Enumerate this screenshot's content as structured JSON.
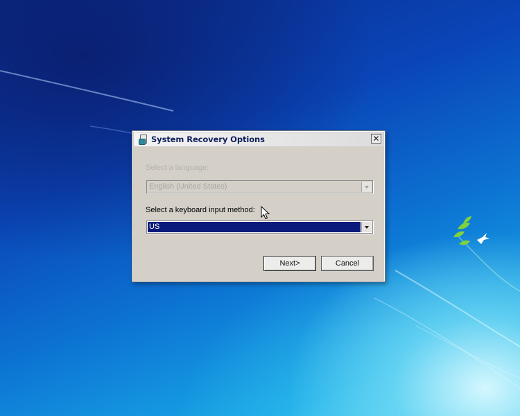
{
  "dialog": {
    "title": "System Recovery Options",
    "close_glyph": "✕",
    "language": {
      "label": "Select a language:",
      "value": "English (United States)",
      "enabled": false
    },
    "keyboard": {
      "label": "Select a keyboard input method:",
      "value": "US",
      "enabled": true
    },
    "buttons": {
      "next": "Next>",
      "cancel": "Cancel"
    }
  },
  "icons": {
    "title": "recovery-disc-icon",
    "close": "close-icon",
    "dropdown": "chevron-down-icon",
    "cursor": "mouse-pointer-icon"
  },
  "colors": {
    "selection": "#0a1a7a",
    "dialog_bg": "#d4d0c8",
    "disabled_text": "#b4b2ac"
  }
}
